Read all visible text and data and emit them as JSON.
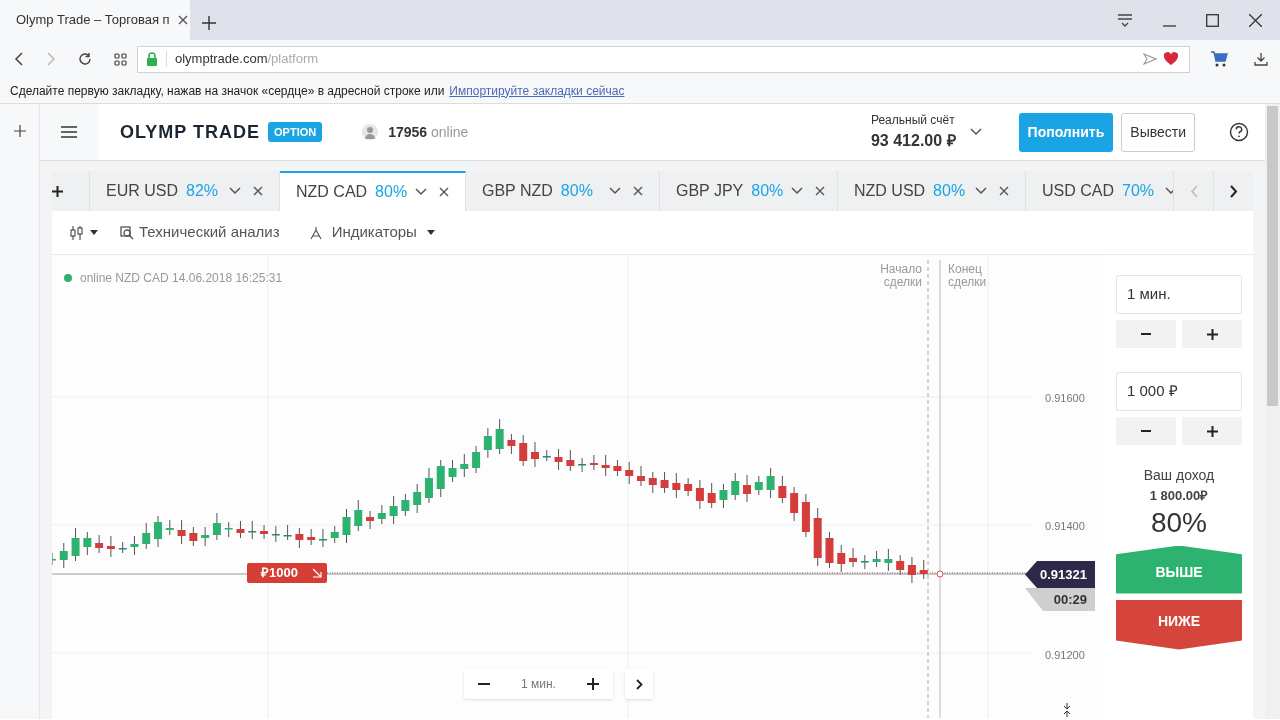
{
  "browser": {
    "tab_title": "Olymp Trade – Торговая п",
    "url_domain": "olymptrade.com",
    "url_path": "/platform",
    "bookmark_hint": "Сделайте первую закладку, нажав на значок «сердце» в адресной строке или",
    "bookmark_link": "Импортируйте закладки сейчас"
  },
  "header": {
    "logo": "OLYMP TRADE",
    "badge": "OPTION",
    "online_count": "17956",
    "online_label": "online",
    "account_label": "Реальный счёт",
    "balance": "93 412.00 ₽",
    "deposit_button": "Пополнить",
    "withdraw_button": "Вывести"
  },
  "asset_tabs": [
    {
      "pair": "EUR USD",
      "payout": "82%",
      "selected": false
    },
    {
      "pair": "NZD CAD",
      "payout": "80%",
      "selected": true
    },
    {
      "pair": "GBP NZD",
      "payout": "80%",
      "selected": false
    },
    {
      "pair": "GBP JPY",
      "payout": "80%",
      "selected": false
    },
    {
      "pair": "NZD USD",
      "payout": "80%",
      "selected": false
    },
    {
      "pair": "USD CAD",
      "payout": "70%",
      "selected": false
    }
  ],
  "toolbar": {
    "technical_analysis": "Технический анализ",
    "indicators": "Индикаторы"
  },
  "chart": {
    "status": "online NZD CAD 14.06.2018 16:25:31",
    "start_label": "Начало сделки",
    "end_label": "Конец сделки",
    "price_labels": [
      "0.91600",
      "0.91400",
      "0.91200"
    ],
    "bet_marker": "₽1000",
    "current_price": "0.91321",
    "timer": "00:29",
    "timeframe": "1 мин."
  },
  "trade_panel": {
    "duration": "1 мин.",
    "amount": "1 000 ₽",
    "income_label": "Ваш доход",
    "income": "1 800.00₽",
    "payout": "80%",
    "up_button": "ВЫШЕ",
    "down_button": "НИЖЕ"
  }
}
